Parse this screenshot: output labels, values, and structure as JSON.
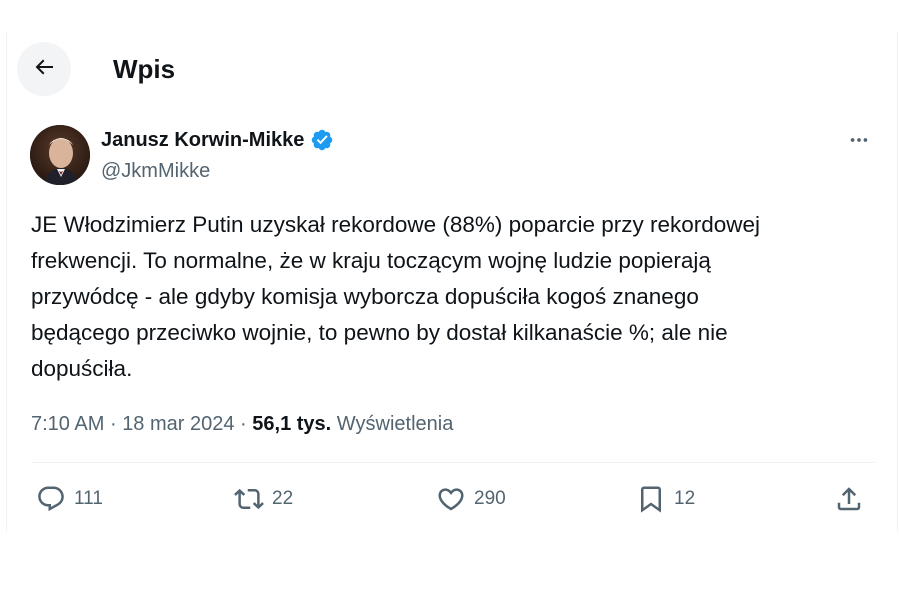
{
  "header": {
    "title": "Wpis",
    "back_icon": "arrow-left-icon"
  },
  "author": {
    "name": "Janusz Korwin-Mikke",
    "handle": "@JkmMikke",
    "verified": true,
    "verified_color": "#1d9bf0"
  },
  "tweet": {
    "text": "JE Włodzimierz Putin uzyskał rekordowe (88%) poparcie przy rekordowej\nfrekwencji. To normalne, że w kraju toczącym wojnę ludzie popierają\nprzywódcę - ale gdyby komisja wyborcza dopuściła kogoś znanego\nbędącego przeciwko wojnie, to pewno by dostał kilkanaście %; ale nie\ndopuściła.",
    "time": "7:10 AM",
    "separator": "·",
    "date": "18 mar 2024",
    "views_count": "56,1 tys.",
    "views_label": "Wyświetlenia"
  },
  "actions": {
    "replies": "111",
    "reposts": "22",
    "likes": "290",
    "bookmarks": "12"
  },
  "colors": {
    "text_primary": "#0f1419",
    "text_secondary": "#536471",
    "divider": "#eff3f4",
    "back_button_bg": "#f2f4f5"
  }
}
